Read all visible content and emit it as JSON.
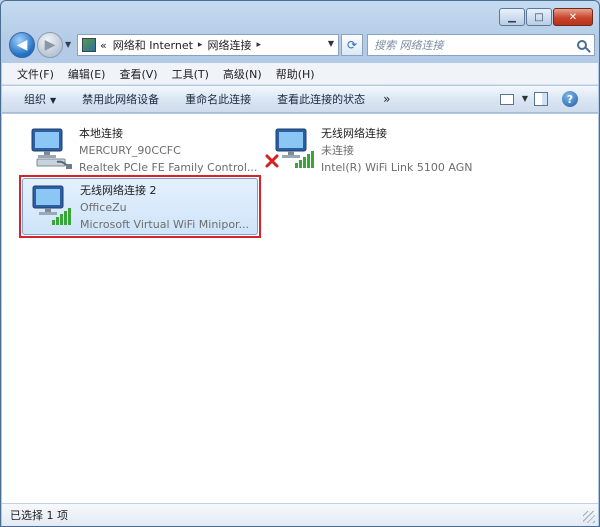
{
  "caption": {
    "minimize": "▁",
    "maximize": "□",
    "close": "✕"
  },
  "nav": {
    "back_glyph": "◀",
    "forward_glyph": "▶",
    "history_glyph": "▼",
    "breadcrumb_prefix": "«",
    "breadcrumbs": [
      "网络和 Internet",
      "网络连接"
    ],
    "crumb_separator": "▸",
    "refresh_glyph": "⟳",
    "search_placeholder": "搜索 网络连接"
  },
  "menu": [
    "文件(F)",
    "编辑(E)",
    "查看(V)",
    "工具(T)",
    "高级(N)",
    "帮助(H)"
  ],
  "commands": {
    "organize": "组织",
    "disable": "禁用此网络设备",
    "rename": "重命名此连接",
    "status": "查看此连接的状态",
    "more": "»",
    "help": "?"
  },
  "connections": [
    {
      "name": "本地连接",
      "network": "MERCURY_90CCFC",
      "device": "Realtek PCIe FE Family Control...",
      "type": "wired",
      "disabled": false,
      "selected": false
    },
    {
      "name": "无线网络连接",
      "network": "未连接",
      "device": "Intel(R) WiFi Link 5100 AGN",
      "type": "wireless",
      "disabled": true,
      "selected": false
    },
    {
      "name": "无线网络连接 2",
      "network": "OfficeZu",
      "device": "Microsoft Virtual WiFi Minipor...",
      "type": "wireless",
      "disabled": false,
      "selected": true
    }
  ],
  "status_bar": "已选择 1 项",
  "colors": {
    "highlight_border": "#d8232a",
    "selection_fill": "#cfe4fa",
    "signal_green": "#3aa53a",
    "disabled_red": "#d42020"
  }
}
